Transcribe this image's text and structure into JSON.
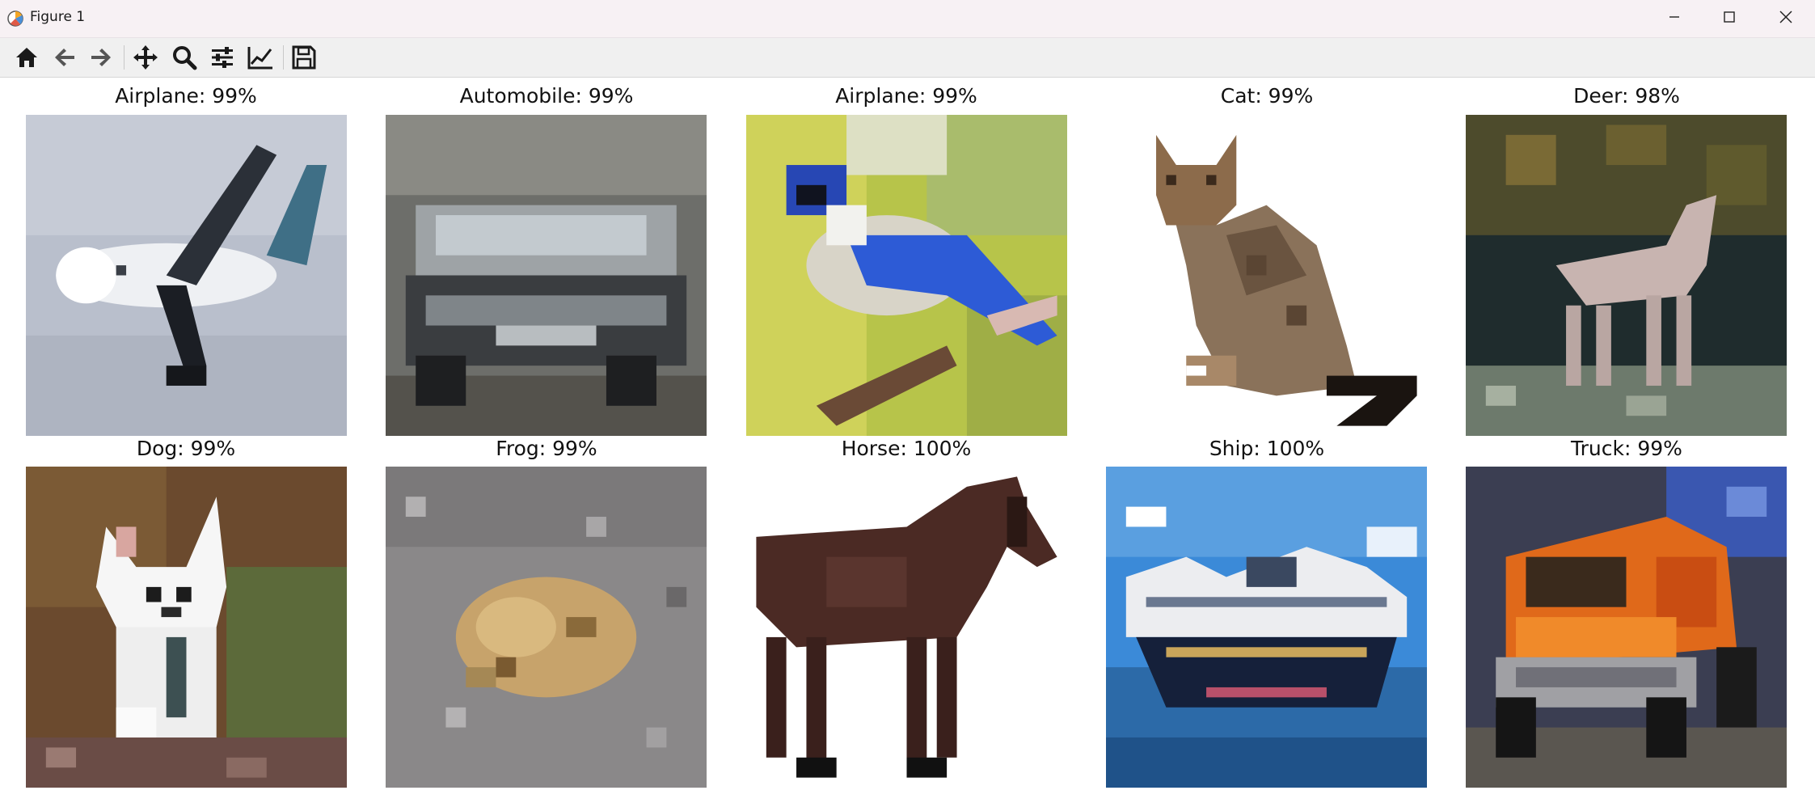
{
  "window": {
    "title": "Figure 1",
    "controls": [
      "minimize-icon",
      "maximize-icon",
      "close-icon"
    ]
  },
  "toolbar": {
    "tools": [
      "home-icon",
      "back-arrow-icon",
      "forward-arrow-icon",
      "pan-icon",
      "zoom-icon",
      "subplots-config-icon",
      "edit-axes-icon",
      "save-icon"
    ]
  },
  "panels": [
    {
      "title": "Airplane: 99%",
      "label": "Airplane",
      "confidence": 99,
      "subject": "airplane"
    },
    {
      "title": "Automobile: 99%",
      "label": "Automobile",
      "confidence": 99,
      "subject": "automobile"
    },
    {
      "title": "Airplane: 99%",
      "label": "Airplane",
      "confidence": 99,
      "subject": "bird"
    },
    {
      "title": "Cat: 99%",
      "label": "Cat",
      "confidence": 99,
      "subject": "cat"
    },
    {
      "title": "Deer: 98%",
      "label": "Deer",
      "confidence": 98,
      "subject": "deer"
    },
    {
      "title": "Dog: 99%",
      "label": "Dog",
      "confidence": 99,
      "subject": "dog"
    },
    {
      "title": "Frog: 99%",
      "label": "Frog",
      "confidence": 99,
      "subject": "frog"
    },
    {
      "title": "Horse: 100%",
      "label": "Horse",
      "confidence": 100,
      "subject": "horse"
    },
    {
      "title": "Ship: 100%",
      "label": "Ship",
      "confidence": 100,
      "subject": "ship"
    },
    {
      "title": "Truck: 99%",
      "label": "Truck",
      "confidence": 99,
      "subject": "truck"
    }
  ],
  "colors": {
    "titlebar_bg": "#f7f1f4",
    "toolbar_bg": "#f0f0f0",
    "icon_color": "#1a1a1a"
  }
}
